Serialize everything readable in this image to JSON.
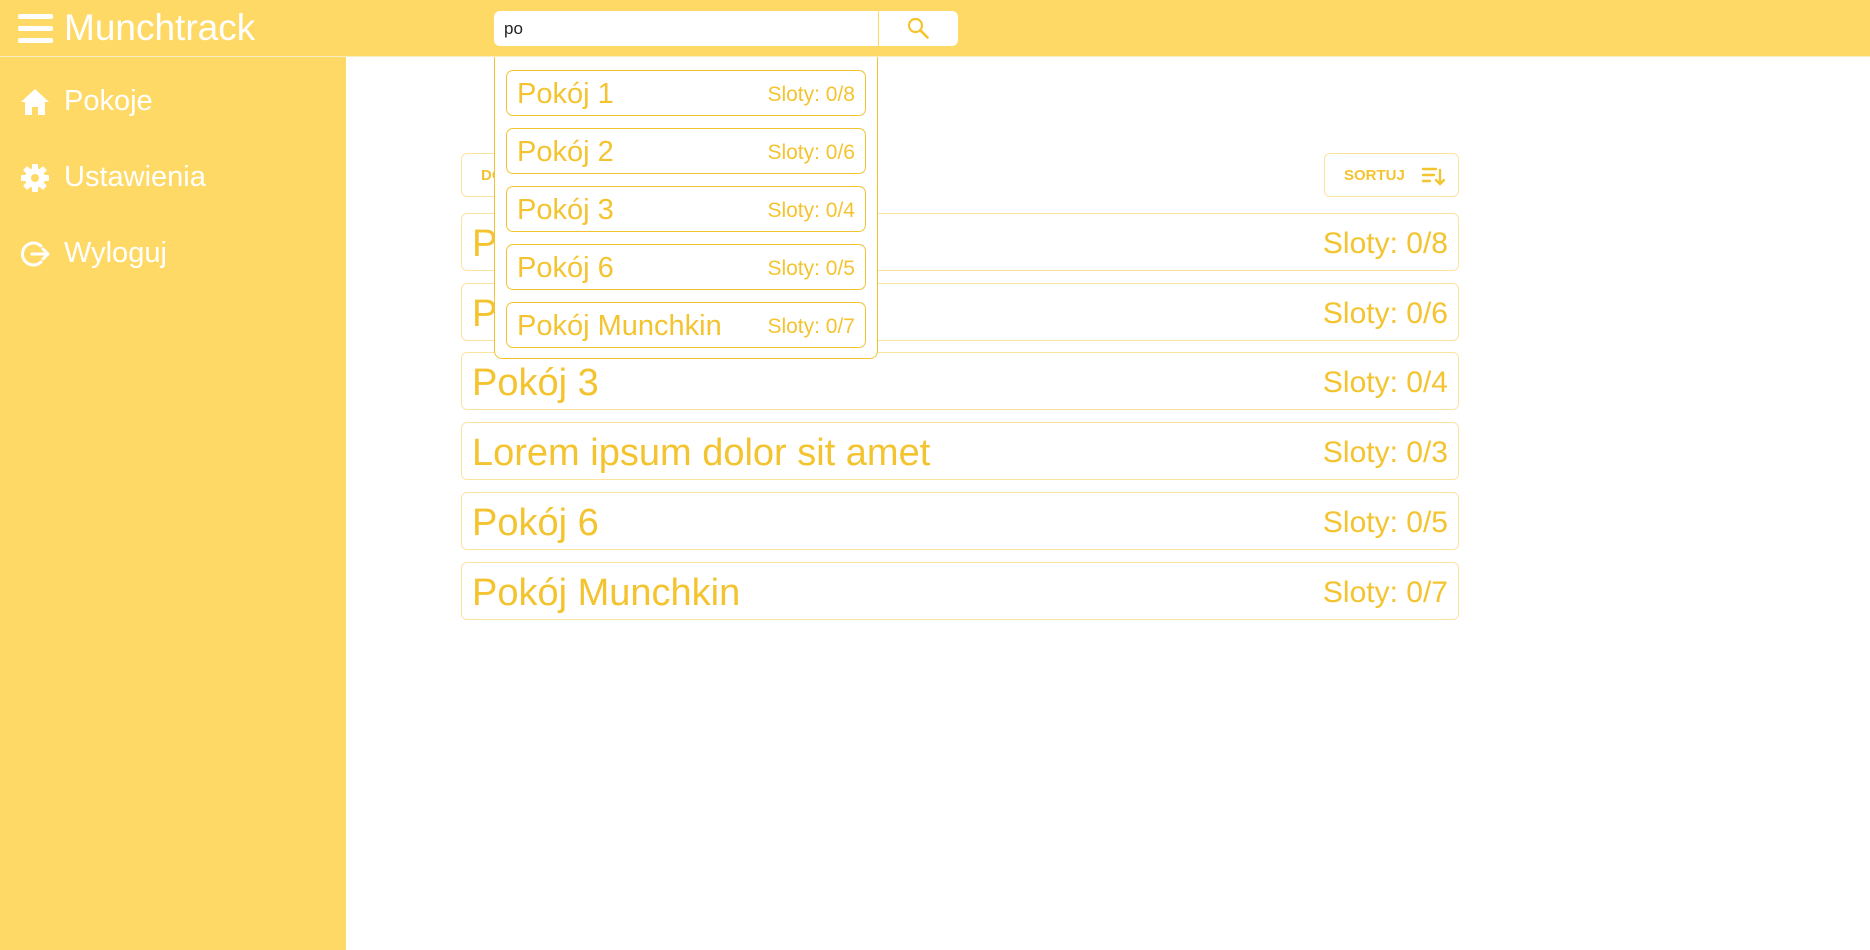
{
  "app": {
    "title": "Munchtrack"
  },
  "search": {
    "value": "po",
    "placeholder": ""
  },
  "sidebar": {
    "items": [
      {
        "label": "Pokoje",
        "icon": "home-icon"
      },
      {
        "label": "Ustawienia",
        "icon": "gear-icon"
      },
      {
        "label": "Wyloguj",
        "icon": "logout-icon"
      }
    ]
  },
  "toolbar": {
    "add_label": "DO",
    "sort_label": "SORTUJ",
    "sort_icon": "sort-icon"
  },
  "rooms": [
    {
      "name": "P",
      "slots": "Sloty: 0/8"
    },
    {
      "name": "P",
      "slots": "Sloty: 0/6"
    },
    {
      "name": "Pokój 3",
      "slots": "Sloty: 0/4"
    },
    {
      "name": "Lorem ipsum dolor sit amet",
      "slots": "Sloty: 0/3"
    },
    {
      "name": "Pokój 6",
      "slots": "Sloty: 0/5"
    },
    {
      "name": "Pokój Munchkin",
      "slots": "Sloty: 0/7"
    }
  ],
  "suggestions": [
    {
      "name": "Pokój 1",
      "slots": "Sloty: 0/8"
    },
    {
      "name": "Pokój 2",
      "slots": "Sloty: 0/6"
    },
    {
      "name": "Pokój 3",
      "slots": "Sloty: 0/4"
    },
    {
      "name": "Pokój 6",
      "slots": "Sloty: 0/5"
    },
    {
      "name": "Pokój Munchkin",
      "slots": "Sloty: 0/7"
    }
  ],
  "colors": {
    "accent": "#ffd966",
    "text_accent": "#f4c430",
    "background": "#ffffff"
  }
}
